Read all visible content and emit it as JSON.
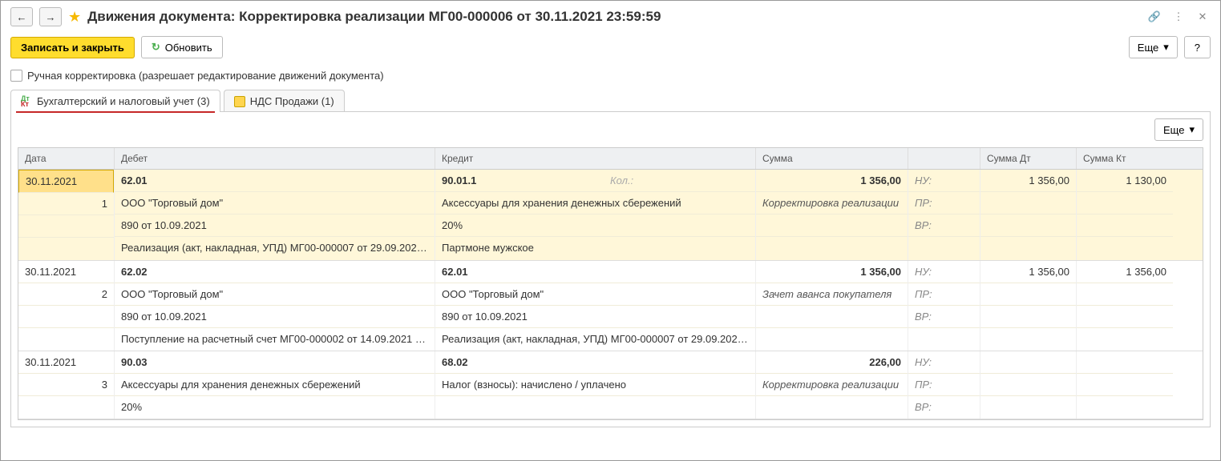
{
  "title": "Движения документа: Корректировка реализации МГ00-000006 от 30.11.2021 23:59:59",
  "toolbar": {
    "save_close": "Записать и закрыть",
    "refresh": "Обновить",
    "more": "Еще",
    "help": "?"
  },
  "checkbox_label": "Ручная корректировка (разрешает редактирование движений документа)",
  "tabs": {
    "accounting": "Бухгалтерский и налоговый учет (3)",
    "vat": "НДС Продажи (1)"
  },
  "grid": {
    "headers": {
      "date": "Дата",
      "debit": "Дебет",
      "credit": "Кредит",
      "sum": "Сумма",
      "sumdt": "Сумма Дт",
      "sumkt": "Сумма Кт"
    },
    "indicators": {
      "nu": "НУ:",
      "pr": "ПР:",
      "vr": "ВР:"
    },
    "kol_label": "Кол.:",
    "rows": [
      {
        "date": "30.11.2021",
        "idx": "1",
        "debit_acc": "62.01",
        "debit_sub1": "ООО \"Торговый дом\"",
        "debit_sub2": "890 от 10.09.2021",
        "debit_sub3": "Реализация (акт, накладная, УПД) МГ00-000007 от 29.09.2021…",
        "credit_acc": "90.01.1",
        "credit_sub1": "Аксессуары для хранения денежных сбережений",
        "credit_sub2": "20%",
        "credit_sub3": "Партмоне мужское",
        "sum": "1 356,00",
        "sum_desc": "Корректировка реализации",
        "sumdt_nu": "1 356,00",
        "sumkt_nu": "1 130,00"
      },
      {
        "date": "30.11.2021",
        "idx": "2",
        "debit_acc": "62.02",
        "debit_sub1": "ООО \"Торговый дом\"",
        "debit_sub2": "890 от 10.09.2021",
        "debit_sub3": "Поступление на расчетный счет МГ00-000002 от 14.09.2021 …",
        "credit_acc": "62.01",
        "credit_sub1": "ООО \"Торговый дом\"",
        "credit_sub2": "890 от 10.09.2021",
        "credit_sub3": "Реализация (акт, накладная, УПД) МГ00-000007 от 29.09.2021…",
        "sum": "1 356,00",
        "sum_desc": "Зачет аванса покупателя",
        "sumdt_nu": "1 356,00",
        "sumkt_nu": "1 356,00"
      },
      {
        "date": "30.11.2021",
        "idx": "3",
        "debit_acc": "90.03",
        "debit_sub1": "Аксессуары для хранения денежных сбережений",
        "debit_sub2": "20%",
        "debit_sub3": "",
        "credit_acc": "68.02",
        "credit_sub1": "Налог (взносы): начислено / уплачено",
        "credit_sub2": "",
        "credit_sub3": "",
        "sum": "226,00",
        "sum_desc": "Корректировка реализации",
        "sumdt_nu": "",
        "sumkt_nu": ""
      }
    ]
  }
}
